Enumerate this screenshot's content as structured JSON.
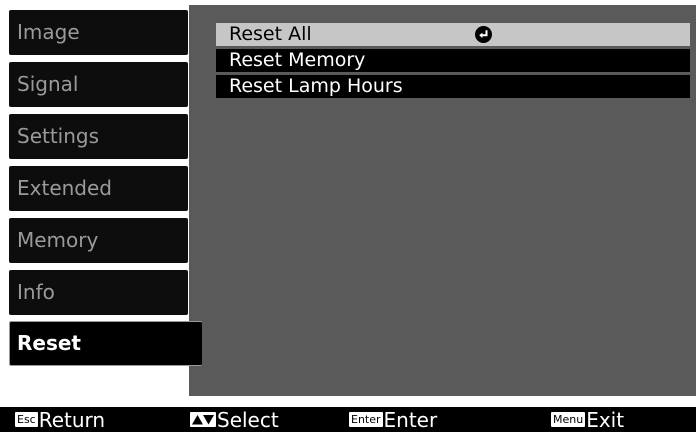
{
  "menu": {
    "tabs": [
      {
        "label": "Image"
      },
      {
        "label": "Signal"
      },
      {
        "label": "Settings"
      },
      {
        "label": "Extended"
      },
      {
        "label": "Memory"
      },
      {
        "label": "Info"
      },
      {
        "label": "Reset"
      }
    ],
    "active_tab": "Reset"
  },
  "submenu": {
    "items": [
      {
        "label": "Reset All",
        "selected": true,
        "icon": "enter-icon"
      },
      {
        "label": "Reset Memory",
        "selected": false
      },
      {
        "label": "Reset Lamp Hours",
        "selected": false
      }
    ]
  },
  "footer": {
    "return": {
      "key": "Esc",
      "label": "Return"
    },
    "select": {
      "key_icon": "up-down-arrows-icon",
      "label": "Select"
    },
    "enter": {
      "key": "Enter",
      "label": "Enter"
    },
    "exit": {
      "key": "Menu",
      "label": "Exit"
    }
  },
  "colors": {
    "panel": "#5a5a5a",
    "tab_background": "#0d0d0d",
    "tab_text": "#9a9a9a",
    "selected_row": "#c6c6c6"
  }
}
